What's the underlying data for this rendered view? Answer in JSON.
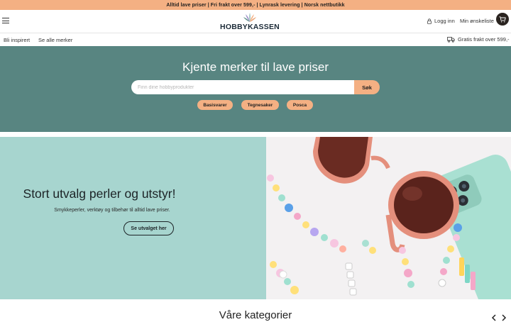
{
  "topbar": {
    "text": "Alltid lave priser | Fri frakt over 599,- | Lynrask levering  | Norsk nettbutikk"
  },
  "header": {
    "logo_text": "HOBBYKASSEN",
    "login_label": "Logg inn",
    "wishlist_label": "Min ønskeliste"
  },
  "nav": {
    "items": [
      {
        "label": "Bli inspirert"
      },
      {
        "label": "Se alle merker"
      }
    ],
    "free_shipping": "Gratis frakt over 599,-"
  },
  "hero": {
    "title": "Kjente merker til lave priser",
    "search_placeholder": "Finn dine hobbyprodukter",
    "search_value": "",
    "search_button": "Søk",
    "chips": [
      {
        "label": "Basisvarer"
      },
      {
        "label": "Tegnesaker"
      },
      {
        "label": "Posca"
      }
    ]
  },
  "promo": {
    "title": "Stort utvalg perler og utstyr!",
    "subtitle": "Smykkeperler, verktøy og tilbehør til alltid lave priser.",
    "button": "Se utvalget her"
  },
  "categories": {
    "title": "Våre kategorier"
  },
  "colors": {
    "topbar": "#f4b083",
    "hero": "#588581",
    "promo": "#a7d5cf",
    "accent": "#f4b083",
    "cart": "#2a2420"
  },
  "icons": [
    "menu-icon",
    "user-icon",
    "cart-icon",
    "truck-icon",
    "chevron-left-icon",
    "chevron-right-icon"
  ]
}
